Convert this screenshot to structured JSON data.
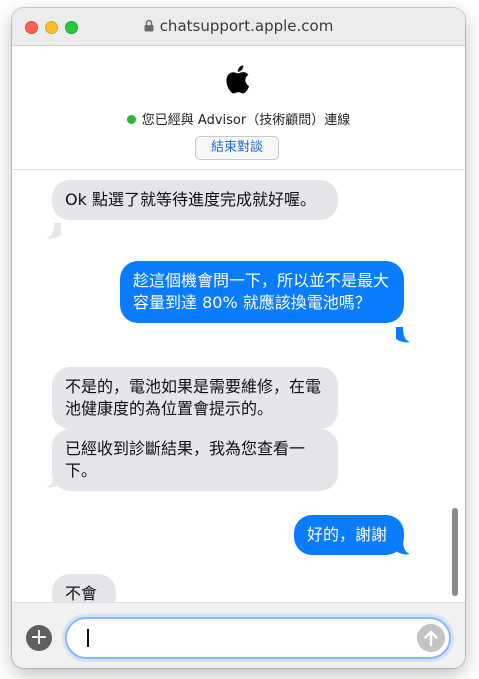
{
  "titlebar": {
    "url": "chatsupport.apple.com"
  },
  "header": {
    "status_text": "您已經與 Advisor（技術顧問）連線",
    "end_button_label": "結束對談"
  },
  "messages": [
    {
      "from": "advisor",
      "text": "Ok 點選了就等待進度完成就好喔。"
    },
    {
      "from": "user",
      "text": "趁這個機會問一下，所以並不是最大容量到達 80% 就應該換電池嗎？"
    },
    {
      "from": "advisor",
      "text": "不是的，電池如果是需要維修，在電池健康度的為位置會提示的。"
    },
    {
      "from": "advisor",
      "text": "已經收到診斷結果，我為您查看一下。"
    },
    {
      "from": "user",
      "text": "好的，謝謝"
    },
    {
      "from": "advisor",
      "text": "不會"
    }
  ],
  "composer": {
    "value": "",
    "placeholder": ""
  },
  "colors": {
    "user_bubble": "#0a7cff",
    "advisor_bubble": "#e5e5ea",
    "online_dot": "#29b33b",
    "accent": "#1a6ed8"
  },
  "icons": {
    "lock": "lock-icon",
    "logo": "apple-logo-icon",
    "add": "plus-icon",
    "send": "send-arrow-icon"
  }
}
